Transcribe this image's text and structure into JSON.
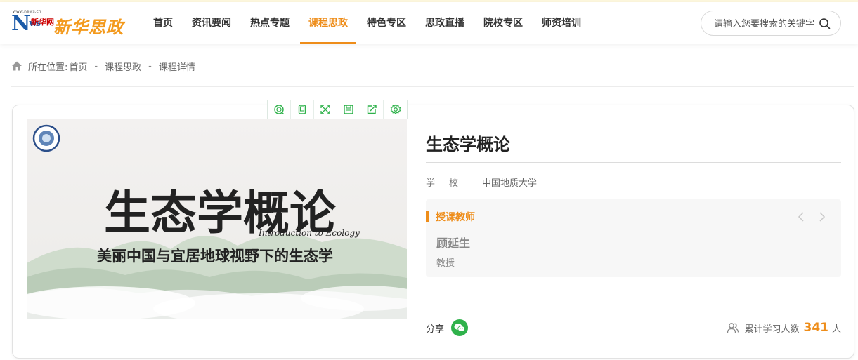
{
  "brand": {
    "logo_site": "新华网",
    "logo_title": "新华思政",
    "logo_mark": "N",
    "logo_mark_sub": "ws",
    "logo_url": "www.news.cn"
  },
  "nav": {
    "items": [
      {
        "label": "首页"
      },
      {
        "label": "资讯要闻"
      },
      {
        "label": "热点专题"
      },
      {
        "label": "课程思政",
        "active": true
      },
      {
        "label": "特色专区"
      },
      {
        "label": "思政直播"
      },
      {
        "label": "院校专区"
      },
      {
        "label": "师资培训"
      }
    ]
  },
  "search": {
    "placeholder": "请输入您要搜索的关键字",
    "icon": "search-icon"
  },
  "breadcrumb": {
    "prefix": "所在位置:",
    "items": [
      "首页",
      "课程思政",
      "课程详情"
    ],
    "separator": "-"
  },
  "toolbar": {
    "icons": [
      "zoom-in-icon",
      "copy-icon",
      "fullscreen-icon",
      "save-icon",
      "share-out-icon",
      "settings-icon"
    ],
    "color": "#2fb24b"
  },
  "course": {
    "title": "生态学概论",
    "school_label": "学校",
    "school": "中国地质大学",
    "cover": {
      "title": "生态学概论",
      "subtitle_en": "Introduction to Ecology",
      "slogan": "美丽中国与宜居地球视野下的生态学"
    }
  },
  "teacher": {
    "section_label": "授课教师",
    "name": "顾延生",
    "title": "教授"
  },
  "share": {
    "label": "分享",
    "icon": "wechat-icon"
  },
  "stats": {
    "label": "累计学习人数",
    "count": "341",
    "unit": "人"
  },
  "colors": {
    "accent": "#ee8d1a",
    "wechat": "#2fb24b",
    "brand_blue": "#1a5aa8"
  }
}
